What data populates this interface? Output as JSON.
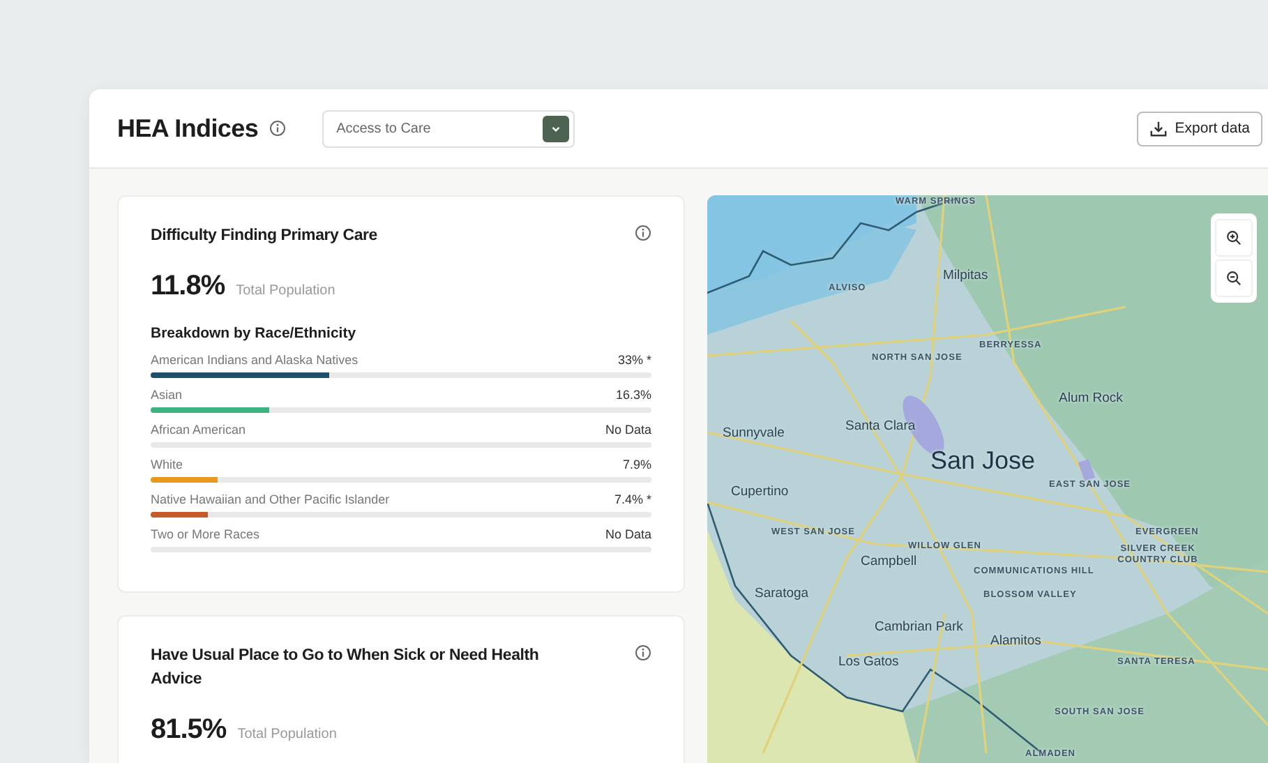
{
  "header": {
    "title": "HEA Indices",
    "dropdown": {
      "value": "Access to Care"
    },
    "export_button": "Export data"
  },
  "cards": [
    {
      "title": "Difficulty Finding Primary Care",
      "value": "11.8%",
      "value_label": "Total Population",
      "breakdown_title": "Breakdown by Race/Ethnicity",
      "rows": [
        {
          "name": "American Indians and Alaska Natives",
          "reading": "33% *",
          "level": 0.357,
          "color": "#1f4e6b"
        },
        {
          "name": "Asian",
          "reading": "16.3%",
          "level": 0.237,
          "color": "#3fb37f"
        },
        {
          "name": "African American",
          "reading": "No Data"
        },
        {
          "name": "White",
          "reading": "7.9%",
          "level": 0.134,
          "color": "#e89a1c"
        },
        {
          "name": "Native Hawaiian and Other Pacific Islander",
          "reading": "7.4% *",
          "level": 0.114,
          "color": "#c65a28"
        },
        {
          "name": "Two or More Races",
          "reading": "No Data"
        }
      ]
    },
    {
      "title": "Have Usual Place to Go to When Sick or Need Health Advice",
      "value": "81.5%",
      "value_label": "Total Population"
    }
  ],
  "map": {
    "labels": [
      {
        "text": "WARM SPRINGS",
        "kind": "district"
      },
      {
        "text": "Milpitas",
        "kind": "city"
      },
      {
        "text": "ALVISO",
        "kind": "district"
      },
      {
        "text": "BERRYESSA",
        "kind": "district"
      },
      {
        "text": "NORTH SAN JOSE",
        "kind": "district"
      },
      {
        "text": "Sunnyvale",
        "kind": "city"
      },
      {
        "text": "Alum Rock",
        "kind": "city"
      },
      {
        "text": "Santa Clara",
        "kind": "city"
      },
      {
        "text": "San Jose",
        "kind": "major"
      },
      {
        "text": "Cupertino",
        "kind": "city"
      },
      {
        "text": "EAST SAN JOSE",
        "kind": "district"
      },
      {
        "text": "WEST SAN JOSE",
        "kind": "district"
      },
      {
        "text": "WILLOW GLEN",
        "kind": "district"
      },
      {
        "text": "EVERGREEN",
        "kind": "district"
      },
      {
        "text": "SILVER CREEK COUNTRY CLUB",
        "kind": "district"
      },
      {
        "text": "Campbell",
        "kind": "city"
      },
      {
        "text": "COMMUNICATIONS HILL",
        "kind": "district"
      },
      {
        "text": "Saratoga",
        "kind": "city"
      },
      {
        "text": "BLOSSOM VALLEY",
        "kind": "district"
      },
      {
        "text": "Cambrian Park",
        "kind": "city"
      },
      {
        "text": "Alamitos",
        "kind": "city"
      },
      {
        "text": "Los Gatos",
        "kind": "city"
      },
      {
        "text": "SANTA TERESA",
        "kind": "district"
      },
      {
        "text": "SOUTH SAN JOSE",
        "kind": "district"
      },
      {
        "text": "ALMADEN",
        "kind": "district"
      }
    ]
  }
}
